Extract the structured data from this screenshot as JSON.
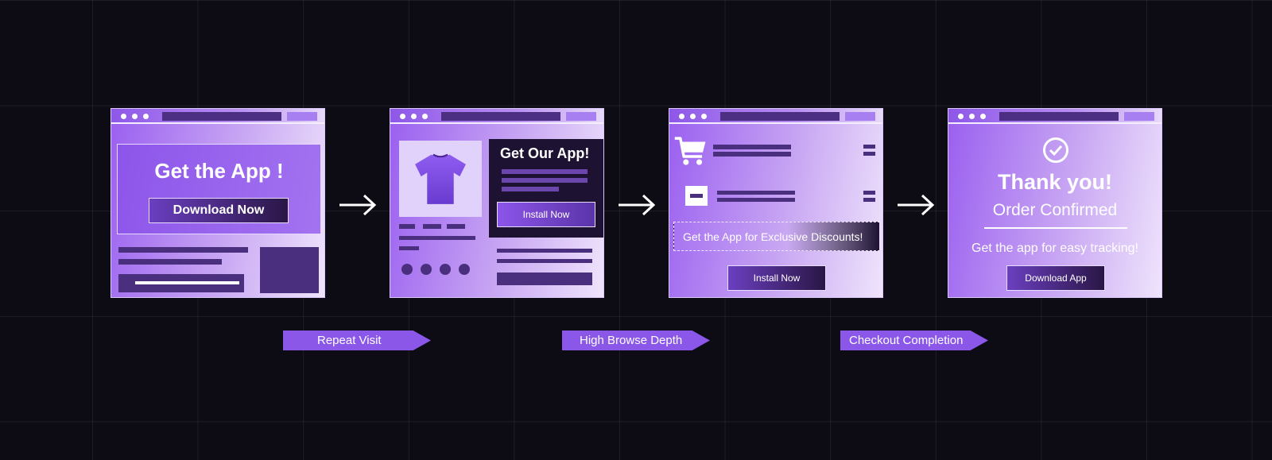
{
  "windows": [
    {
      "headline": "Get the App !",
      "button": "Download Now"
    },
    {
      "headline": "Get Our App!",
      "button": "Install Now"
    },
    {
      "banner": "Get the App for Exclusive Discounts!",
      "button": "Install Now"
    },
    {
      "headline": "Thank you!",
      "subheadline": "Order Confirmed",
      "body": "Get the app for easy tracking!",
      "button": "Download App"
    }
  ],
  "triggers": [
    {
      "label": "Repeat Visit"
    },
    {
      "label": "High Browse Depth"
    },
    {
      "label": "Checkout Completion"
    }
  ],
  "icons": [
    "tshirt-icon",
    "cart-icon",
    "minus-icon",
    "check-circle-icon",
    "arrow-right-icon"
  ],
  "colors": {
    "background": "#0d0b14",
    "accent": "#8a57e8",
    "dark_panel": "#1e1233",
    "bar": "#4a2f7f"
  }
}
